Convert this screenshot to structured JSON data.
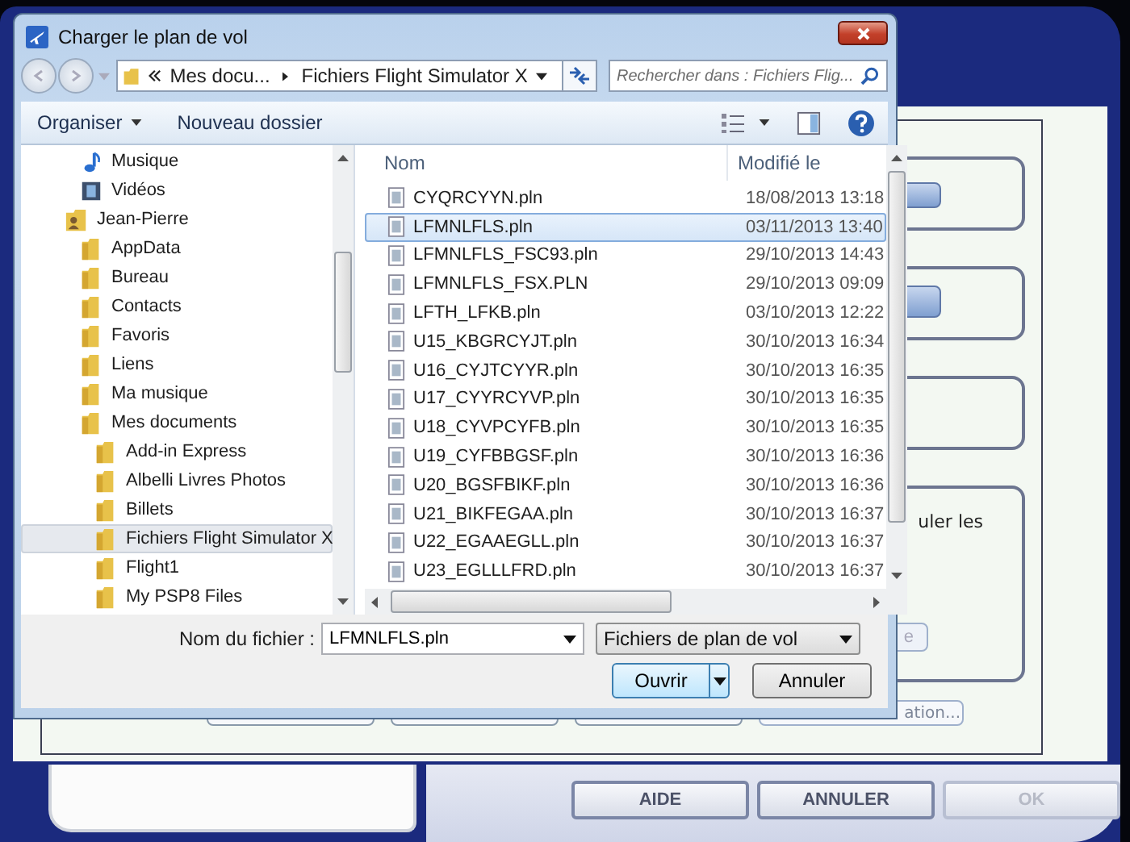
{
  "dialog": {
    "title": "Charger le plan de vol",
    "address": {
      "crumbs": [
        "Mes docu...",
        "Fichiers Flight Simulator X"
      ]
    },
    "search": {
      "placeholder": "Rechercher dans : Fichiers Flig..."
    },
    "toolbar": {
      "organise": "Organiser",
      "new_folder": "Nouveau dossier"
    },
    "tree": [
      {
        "label": "Musique",
        "kind": "music",
        "selected": false
      },
      {
        "label": "Vidéos",
        "kind": "video",
        "selected": false
      },
      {
        "label": "Jean-Pierre",
        "kind": "user",
        "selected": false,
        "children": [
          {
            "label": "AppData",
            "kind": "folder",
            "selected": false
          },
          {
            "label": "Bureau",
            "kind": "folder",
            "selected": false
          },
          {
            "label": "Contacts",
            "kind": "folder",
            "selected": false
          },
          {
            "label": "Favoris",
            "kind": "folder",
            "selected": false
          },
          {
            "label": "Liens",
            "kind": "folder",
            "selected": false
          },
          {
            "label": "Ma musique",
            "kind": "folder",
            "selected": false
          },
          {
            "label": "Mes documents",
            "kind": "folder",
            "selected": false,
            "children": [
              {
                "label": "Add-in Express",
                "kind": "folder",
                "selected": false
              },
              {
                "label": "Albelli Livres Photos",
                "kind": "folder",
                "selected": false
              },
              {
                "label": "Billets",
                "kind": "folder",
                "selected": false
              },
              {
                "label": "Fichiers Flight Simulator X",
                "kind": "folder",
                "selected": true
              },
              {
                "label": "Flight1",
                "kind": "folder",
                "selected": false
              },
              {
                "label": "My PSP8 Files",
                "kind": "folder",
                "selected": false
              }
            ]
          }
        ]
      }
    ],
    "columns": [
      "Nom",
      "Modifié le"
    ],
    "files": [
      {
        "name": "CYQRCYYN.pln",
        "modified": "18/08/2013 13:18",
        "selected": false
      },
      {
        "name": "LFMNLFLS.pln",
        "modified": "03/11/2013 13:40",
        "selected": true
      },
      {
        "name": "LFMNLFLS_FSC93.pln",
        "modified": "29/10/2013 14:43",
        "selected": false
      },
      {
        "name": "LFMNLFLS_FSX.PLN",
        "modified": "29/10/2013 09:09",
        "selected": false
      },
      {
        "name": "LFTH_LFKB.pln",
        "modified": "03/10/2013 12:22",
        "selected": false
      },
      {
        "name": "U15_KBGRCYJT.pln",
        "modified": "30/10/2013 16:34",
        "selected": false
      },
      {
        "name": "U16_CYJTCYYR.pln",
        "modified": "30/10/2013 16:35",
        "selected": false
      },
      {
        "name": "U17_CYYRCYVP.pln",
        "modified": "30/10/2013 16:35",
        "selected": false
      },
      {
        "name": "U18_CYVPCYFB.pln",
        "modified": "30/10/2013 16:35",
        "selected": false
      },
      {
        "name": "U19_CYFBBGSF.pln",
        "modified": "30/10/2013 16:36",
        "selected": false
      },
      {
        "name": "U20_BGSFBIKF.pln",
        "modified": "30/10/2013 16:36",
        "selected": false
      },
      {
        "name": "U21_BIKFEGAA.pln",
        "modified": "30/10/2013 16:37",
        "selected": false
      },
      {
        "name": "U22_EGAAEGLL.pln",
        "modified": "30/10/2013 16:37",
        "selected": false
      },
      {
        "name": "U23_EGLLLFRD.pln",
        "modified": "30/10/2013 16:37",
        "selected": false
      }
    ],
    "filename": {
      "label": "Nom du fichier :",
      "value": "LFMNLFLS.pln"
    },
    "filetype": "Fichiers de plan de vol",
    "buttons": {
      "open": "Ouvrir",
      "cancel": "Annuler"
    }
  },
  "background_app": {
    "partial_text": "uler les",
    "partial_button": "e",
    "partial_button_2": "ation...",
    "buttons": [
      {
        "label": "AIDE",
        "disabled": false
      },
      {
        "label": "ANNULER",
        "disabled": false
      },
      {
        "label": "OK",
        "disabled": true
      }
    ]
  }
}
